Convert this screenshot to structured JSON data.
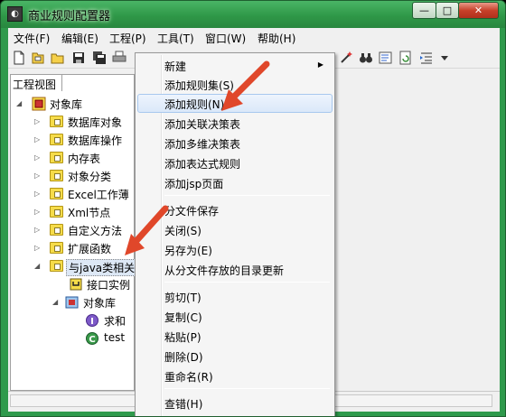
{
  "window": {
    "title": "商业规则配置器",
    "controls": {
      "minimize": "—",
      "maximize": "□",
      "close": "✕"
    }
  },
  "menubar": [
    "文件(F)",
    "编辑(E)",
    "工程(P)",
    "工具(T)",
    "窗口(W)",
    "帮助(H)"
  ],
  "toolbar": {
    "icons": [
      "new-file-icon",
      "open-file-icon",
      "open-folder-icon",
      "save-icon",
      "save-all-icon",
      "print-icon",
      "wand-icon",
      "binoculars-icon",
      "properties-icon",
      "refresh-icon",
      "indent-icon",
      "dropdown-icon"
    ]
  },
  "panel": {
    "tab_label": "工程视图",
    "tree": {
      "root": "对象库",
      "items": [
        "数据库对象",
        "数据库操作",
        "内存表",
        "对象分类",
        "Excel工作薄",
        "Xml节点",
        "自定义方法",
        "扩展函数",
        "与java类相关"
      ],
      "java_children": {
        "interface": "接口实例",
        "lib": "对象库",
        "lib_children": [
          "求和",
          "test"
        ]
      }
    }
  },
  "context_menu": {
    "items": [
      "新建",
      "添加规则集(S)",
      "添加规则(N)",
      "添加关联决策表",
      "添加多维决策表",
      "添加表达式规则",
      "添加jsp页面",
      "分文件保存",
      "关闭(S)",
      "另存为(E)",
      "从分文件存放的目录更新",
      "剪切(T)",
      "复制(C)",
      "粘贴(P)",
      "删除(D)",
      "重命名(R)",
      "查错(H)"
    ],
    "highlighted_index": 2
  },
  "colors": {
    "titlebar": "#2f9a4c",
    "menu_highlight": "#dbe8f9",
    "arrow": "#e0472a",
    "folder": "#f6dc4a"
  }
}
